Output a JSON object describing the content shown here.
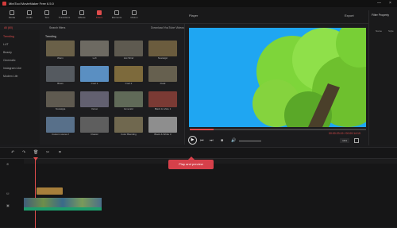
{
  "window": {
    "title": "MiniTool MovieMaker Free 6.5.0"
  },
  "toolbar": {
    "items": [
      {
        "label": "Media"
      },
      {
        "label": "Audio"
      },
      {
        "label": "Text"
      },
      {
        "label": "Transitions"
      },
      {
        "label": "Effects"
      },
      {
        "label": "Filters"
      },
      {
        "label": "Elements"
      },
      {
        "label": "Motion"
      }
    ]
  },
  "left_panel": {
    "all_label": "All (60)",
    "search_label": "Search filters",
    "download_label": "Download YouTube Videos",
    "section_title": "Trending",
    "categories": [
      "Trending",
      "LUT",
      "Beauty",
      "Cinematic",
      "Instagram Like",
      "Modern Life"
    ],
    "thumb_labels": [
      "Warm",
      "Lofi",
      "Hot Wind",
      "Nostalgic",
      "Blues",
      "Cool 1",
      "Cool 2",
      "Dusk",
      "Nostalgia",
      "Velvet",
      "Emerald",
      "Black & white 1",
      "Custom scene 2",
      "Classic",
      "Color Blending",
      "Black & White 3"
    ]
  },
  "player": {
    "title": "Player",
    "export_label": "Export",
    "time": "00:00:23:19 / 00:00:14:19",
    "ratio": "16:9"
  },
  "property_panel": {
    "title": "Filter Property",
    "tab_name": "Name",
    "tab_style": "Style"
  },
  "tooltip": {
    "text": "Play and preview"
  },
  "colors": {
    "accent": "#e04c4c",
    "tooltip_bg": "#d6404a",
    "video_sky": "#1fa6f2",
    "foliage": "#7ed53a",
    "track_green": "#1e9e6d"
  }
}
